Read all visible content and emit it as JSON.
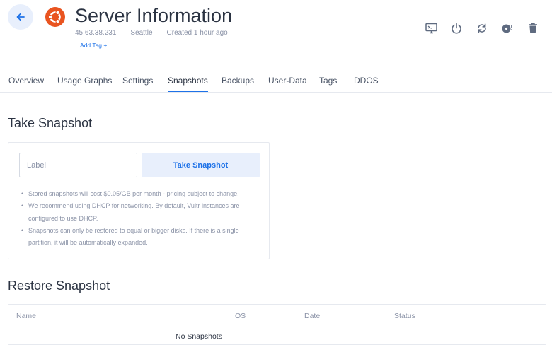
{
  "header": {
    "title": "Server Information",
    "ip": "45.63.38.231",
    "location": "Seattle",
    "created": "Created 1 hour ago",
    "add_tag": "Add Tag +",
    "os_logo": "ubuntu-logo",
    "accent_color": "#1e72e8",
    "logo_color": "#e95420"
  },
  "toolbar": {
    "icons": [
      "console-icon",
      "power-icon",
      "restart-icon",
      "disc-icon",
      "trash-icon"
    ]
  },
  "tabs": [
    "Overview",
    "Usage Graphs",
    "Settings",
    "Snapshots",
    "Backups",
    "User-Data",
    "Tags",
    "DDOS"
  ],
  "active_tab": "Snapshots",
  "take_snapshot": {
    "heading": "Take Snapshot",
    "label_placeholder": "Label",
    "label_value": "",
    "button": "Take Snapshot",
    "notes": [
      "Stored snapshots will cost $0.05/GB per month - pricing subject to change.",
      "We recommend using DHCP for networking. By default, Vultr instances are configured to use DHCP.",
      "Snapshots can only be restored to equal or bigger disks. If there is a single partition, it will be automatically expanded."
    ]
  },
  "restore_snapshot": {
    "heading": "Restore Snapshot",
    "columns": [
      "Name",
      "OS",
      "Date",
      "Status"
    ],
    "empty_text": "No Snapshots"
  }
}
